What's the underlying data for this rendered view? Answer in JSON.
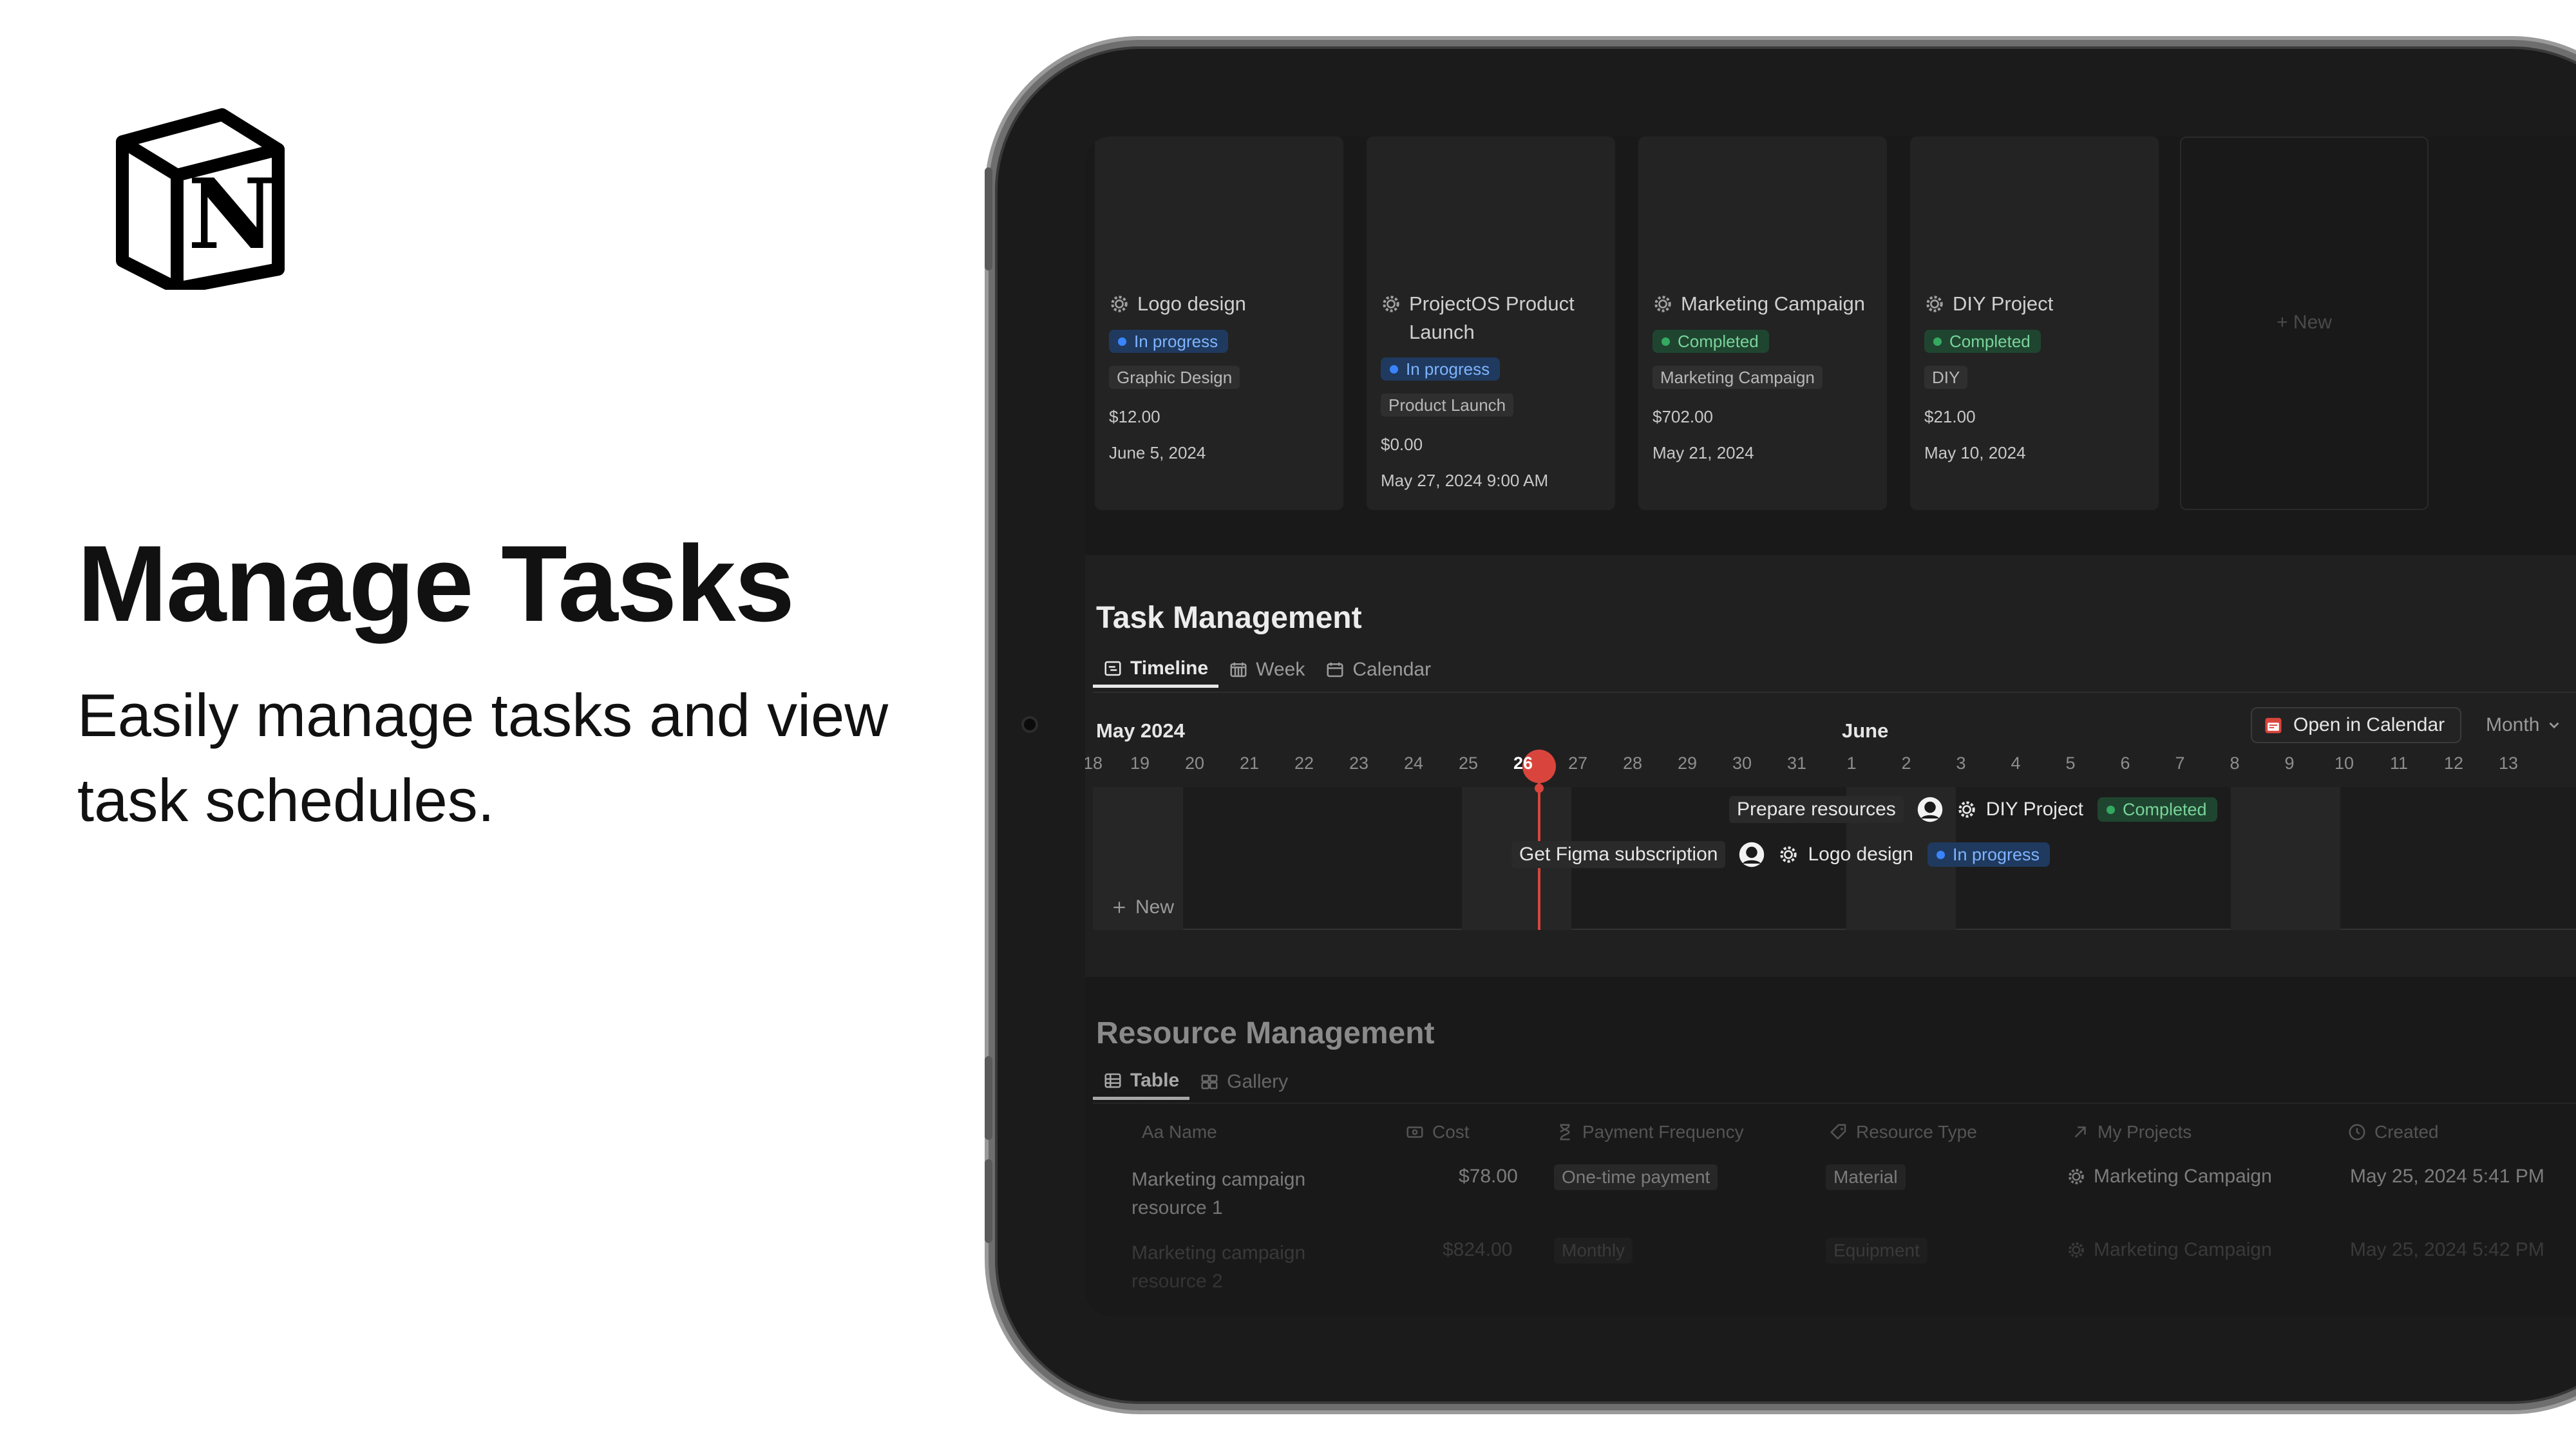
{
  "promo": {
    "logo_icon": "notion-logo",
    "headline": "Manage Tasks",
    "subheadline": "Easily manage tasks and view task schedules."
  },
  "gallery": {
    "cards": [
      {
        "title": "Logo design",
        "status": "In progress",
        "status_color": "blue",
        "tag": "Graphic Design",
        "amount": "$12.00",
        "date": "June 5, 2024"
      },
      {
        "title": "ProjectOS Product Launch",
        "status": "In progress",
        "status_color": "blue",
        "tag": "Product Launch",
        "amount": "$0.00",
        "date": "May 27, 2024 9:00 AM"
      },
      {
        "title": "Marketing Campaign",
        "status": "Completed",
        "status_color": "green",
        "tag": "Marketing Campaign",
        "amount": "$702.00",
        "date": "May 21, 2024"
      },
      {
        "title": "DIY Project",
        "status": "Completed",
        "status_color": "green",
        "tag": "DIY",
        "amount": "$21.00",
        "date": "May 10, 2024"
      }
    ],
    "new_label": "+ New"
  },
  "tasks": {
    "title": "Task Management",
    "tabs": [
      {
        "label": "Timeline",
        "icon": "timeline-icon",
        "active": true
      },
      {
        "label": "Week",
        "icon": "week-icon",
        "active": false
      },
      {
        "label": "Calendar",
        "icon": "calendar-icon",
        "active": false
      }
    ],
    "month_left": "May 2024",
    "month_right": "June",
    "open_calendar": "Open in Calendar",
    "month_select": "Month",
    "days": [
      "18",
      "19",
      "20",
      "21",
      "22",
      "23",
      "24",
      "25",
      "26",
      "27",
      "28",
      "29",
      "30",
      "31",
      "1",
      "2",
      "3",
      "4",
      "5",
      "6",
      "7",
      "8",
      "9",
      "10",
      "11",
      "12",
      "13"
    ],
    "today": "26",
    "events": [
      {
        "name": "Prepare resources",
        "project": "DIY Project",
        "status": "Completed",
        "status_color": "green"
      },
      {
        "name": "Get Figma subscription",
        "project": "Logo design",
        "status": "In progress",
        "status_color": "blue"
      }
    ],
    "new_label": "New"
  },
  "resources": {
    "title": "Resource Management",
    "tabs": [
      {
        "label": "Table",
        "icon": "table-icon",
        "active": true
      },
      {
        "label": "Gallery",
        "icon": "gallery-icon",
        "active": false
      }
    ],
    "columns": [
      "Aa Name",
      "Cost",
      "Payment Frequency",
      "Resource Type",
      "My Projects",
      "Created"
    ],
    "rows": [
      {
        "name": "Marketing campaign resource 1",
        "cost": "$78.00",
        "frequency": "One-time payment",
        "type": "Material",
        "project": "Marketing Campaign",
        "created": "May 25, 2024 5:41 PM"
      },
      {
        "name": "Marketing campaign resource 2",
        "cost": "$824.00",
        "frequency": "Monthly",
        "type": "Equipment",
        "project": "Marketing Campaign",
        "created": "May 25, 2024 5:42 PM"
      }
    ]
  }
}
